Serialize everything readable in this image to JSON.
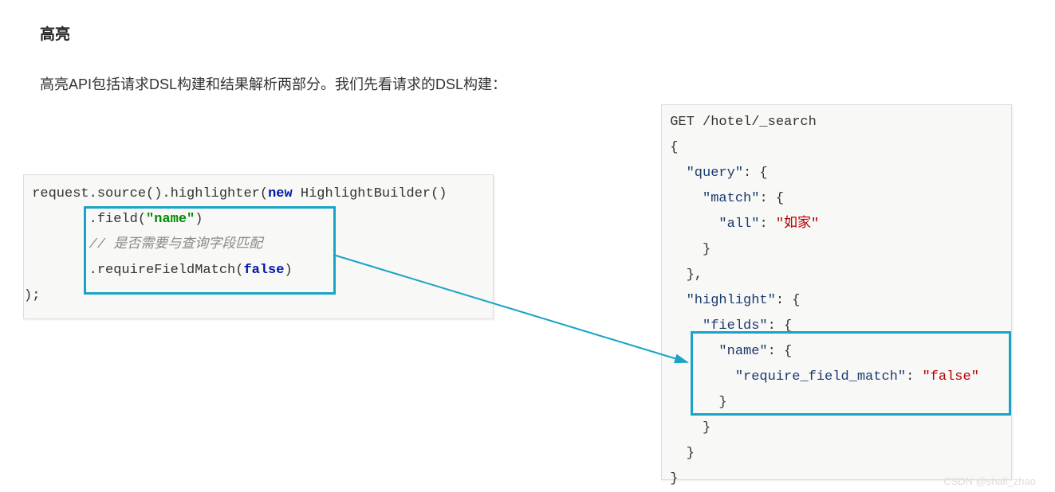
{
  "heading": "高亮",
  "paragraph": "高亮API包括请求DSL构建和结果解析两部分。我们先看请求的DSL构建：",
  "left_code": {
    "l1_a": "request.source().highlighter(",
    "l1_kw": "new",
    "l1_b": " HighlightBuilder()",
    "l2_a": "        .field(",
    "l2_str": "\"name\"",
    "l2_b": ")",
    "l3_comment": "        // 是否需要与查询字段匹配",
    "l4_a": "        .requireFieldMatch(",
    "l4_kw": "false",
    "l4_b": ")",
    "l5": ");"
  },
  "right_code": {
    "l1": "GET /hotel/_search",
    "l2": "{",
    "l3a": "  ",
    "l3k": "\"query\"",
    "l3b": ": {",
    "l4a": "    ",
    "l4k": "\"match\"",
    "l4b": ": {",
    "l5a": "      ",
    "l5k": "\"all\"",
    "l5b": ": ",
    "l5v": "\"如家\"",
    "l6": "    }",
    "l7": "  },",
    "l8a": "  ",
    "l8k": "\"highlight\"",
    "l8b": ": {",
    "l9a": "    ",
    "l9k": "\"fields\"",
    "l9b": ": {",
    "l10a": "      ",
    "l10k": "\"name\"",
    "l10b": ": {",
    "l11a": "        ",
    "l11k": "\"require_field_match\"",
    "l11b": ": ",
    "l11v": "\"false\"",
    "l12": "      }",
    "l13": "    }",
    "l14": "  }",
    "l15": "}"
  },
  "watermark": "CSDN @shall_zhao"
}
